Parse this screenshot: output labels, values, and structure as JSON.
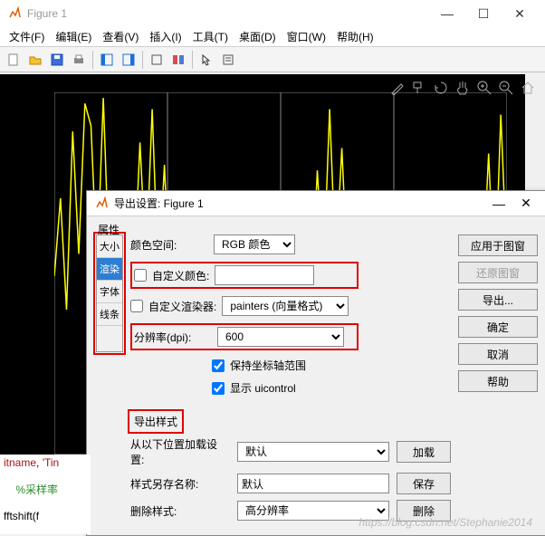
{
  "window": {
    "title": "Figure 1",
    "menus": [
      "文件(F)",
      "编辑(E)",
      "查看(V)",
      "插入(I)",
      "工具(T)",
      "桌面(D)",
      "窗口(W)",
      "帮助(H)"
    ]
  },
  "chart_data": {
    "type": "line",
    "ylabel": "",
    "xlabel": "",
    "ylim": [
      -3,
      3.5
    ],
    "yticks": [
      -3,
      -2,
      -1,
      0,
      1,
      2,
      3
    ],
    "x": [
      0,
      1,
      2,
      3,
      4,
      5,
      6,
      7,
      8,
      9,
      10,
      11,
      12,
      13,
      14,
      15,
      16,
      17,
      18,
      19,
      20,
      21,
      22,
      23,
      24,
      25,
      26,
      27,
      28,
      29,
      30,
      31,
      32,
      33,
      34,
      35,
      36,
      37,
      38,
      39,
      40,
      41,
      42,
      43,
      44,
      45,
      46,
      47,
      48,
      49,
      50,
      51,
      52,
      53,
      54,
      55,
      56,
      57,
      58,
      59,
      60,
      61,
      62,
      63,
      64,
      65,
      66,
      67,
      68,
      69,
      70,
      71,
      72,
      73,
      74
    ],
    "y": [
      0.2,
      1.6,
      -0.4,
      2.8,
      0.6,
      3.3,
      2.9,
      0.3,
      3.4,
      0.3,
      -0.1,
      0.2,
      1.5,
      0.1,
      2.6,
      0.4,
      3.2,
      0.1,
      2.2,
      -0.2,
      0.9,
      0.1,
      0.6,
      0.3,
      0.2,
      0.1,
      0.2,
      0.1,
      0.1,
      -0.1,
      -0.6,
      -0.1,
      -0.3,
      -0.2,
      -0.8,
      0.1,
      -0.2,
      -0.4,
      -0.1,
      0.6,
      -0.1,
      1.1,
      -0.2,
      2.1,
      0.2,
      3.2,
      0.4,
      2.5,
      0.1,
      1.2,
      0.2,
      0.3,
      -0.1,
      0.2,
      0.1,
      0.1,
      -0.1,
      0.1,
      0.2,
      -0.3,
      -0.5,
      0.1,
      -0.7,
      -0.2,
      -0.9,
      0.3,
      -0.4,
      0.5,
      -0.3,
      1.2,
      0.1,
      2.4,
      -0.1,
      3.1,
      0.4
    ],
    "grid_x": 4,
    "line_color": "#ffff00"
  },
  "dialog": {
    "title": "导出设置: Figure 1",
    "prop_label": "属性",
    "tabs": [
      "大小",
      "渲染",
      "字体",
      "线条"
    ],
    "active_tab": 1,
    "color_space_label": "颜色空间:",
    "color_space_value": "RGB 颜色",
    "custom_color_label": "自定义颜色:",
    "custom_color_value": "",
    "custom_renderer_label": "自定义渲染器:",
    "custom_renderer_value": "painters (向量格式)",
    "dpi_label": "分辨率(dpi):",
    "dpi_value": "600",
    "keep_axes_label": "保持坐标轴范围",
    "show_uicontrol_label": "显示 uicontrol",
    "export_style_label": "导出样式",
    "load_from_label": "从以下位置加载设置:",
    "load_from_value": "默认",
    "load_btn": "加载",
    "save_as_label": "样式另存名称:",
    "save_as_value": "默认",
    "save_btn": "保存",
    "delete_label": "删除样式:",
    "delete_value": "高分辨率",
    "delete_btn": "删除",
    "buttons": {
      "apply": "应用于图窗",
      "restore": "还原图窗",
      "export": "导出...",
      "ok": "确定",
      "cancel": "取消",
      "help": "帮助"
    }
  },
  "code": {
    "l1a": "itname",
    "l1b": ",",
    "l1c": "'Tin",
    "l2": "%采样率",
    "l3": "fftshift(f"
  },
  "watermark": "https://blog.csdn.net/Stephanie2014"
}
